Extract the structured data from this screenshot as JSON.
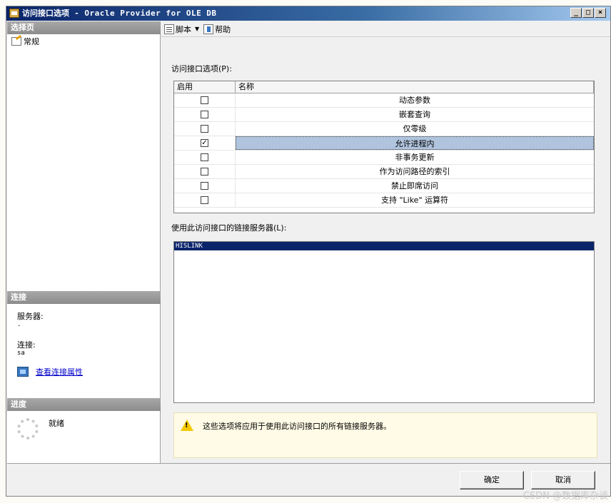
{
  "window": {
    "title_zh": "访问接口选项",
    "title_latin": " - Oracle Provider for OLE DB",
    "buttons": {
      "minimize": "_",
      "restore": "□",
      "close": "×"
    }
  },
  "left": {
    "select_page_header": "选择页",
    "pages": [
      {
        "label": "常规"
      }
    ],
    "connection_header": "连接",
    "server_label": "服务器:",
    "server_value": ".",
    "connection_label": "连接:",
    "connection_value": "sa",
    "view_connection_link": "查看连接属性",
    "progress_header": "进度",
    "progress_status": "就绪"
  },
  "toolbar": {
    "script_label": "脚本",
    "help_label": "帮助"
  },
  "main": {
    "options_label": "访问接口选项(P):",
    "columns": [
      "启用",
      "名称"
    ],
    "options": [
      {
        "name": "动态参数",
        "checked": false,
        "selected": false
      },
      {
        "name": "嵌套查询",
        "checked": false,
        "selected": false
      },
      {
        "name": "仅零级",
        "checked": false,
        "selected": false
      },
      {
        "name": "允许进程内",
        "checked": true,
        "selected": true
      },
      {
        "name": "非事务更新",
        "checked": false,
        "selected": false
      },
      {
        "name": "作为访问路径的索引",
        "checked": false,
        "selected": false
      },
      {
        "name": "禁止即席访问",
        "checked": false,
        "selected": false
      },
      {
        "name": "支持 \"Like\" 运算符",
        "checked": false,
        "selected": false
      }
    ],
    "linked_servers_label": "使用此访问接口的链接服务器(L):",
    "linked_servers": [
      "HISLINK"
    ],
    "info_message": "这些选项将应用于使用此访问接口的所有链接服务器。"
  },
  "footer": {
    "ok_label": "确定",
    "cancel_label": "取消"
  },
  "watermark": "CSDN @数据库杂谈",
  "colors": {
    "title_gradient_start": "#0a246a",
    "selection": "#0a246a",
    "selected_row": "#b0c4de",
    "info_background": "#fffbe6",
    "warning_icon": "#f5c800"
  }
}
